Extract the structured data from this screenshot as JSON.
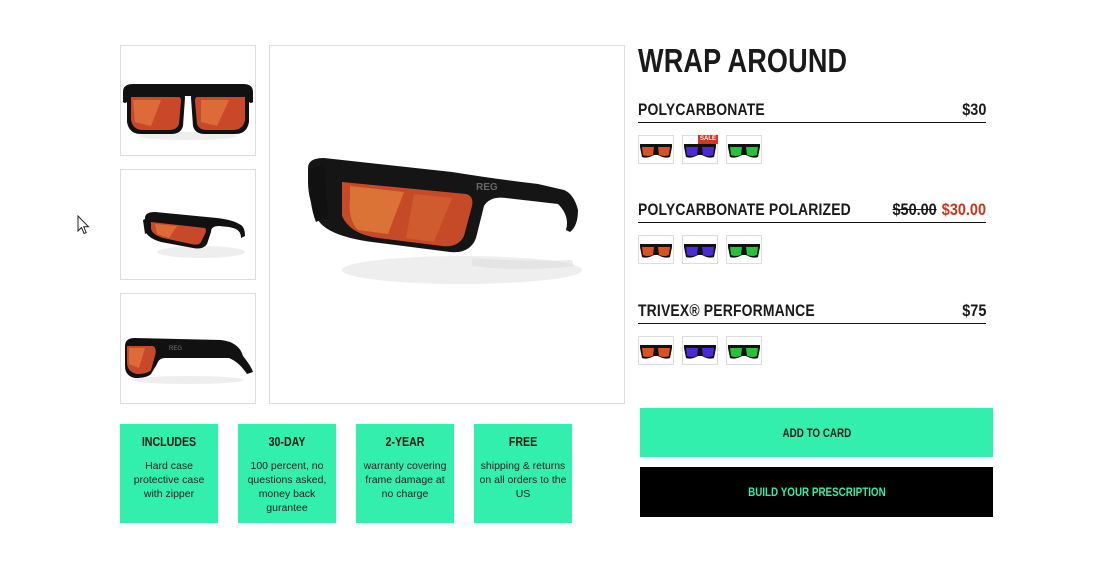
{
  "product": {
    "title": "WRAP AROUND",
    "main_image_icon": "sunglasses-angled-view",
    "thumbnails": [
      {
        "icon": "sunglasses-front-view"
      },
      {
        "icon": "sunglasses-angled-view"
      },
      {
        "icon": "sunglasses-side-view"
      }
    ]
  },
  "options": [
    {
      "name": "POLYCARBONATE",
      "price": "$30",
      "swatches": [
        {
          "color": "orange-mirror",
          "hex": "#d9531f",
          "badge": ""
        },
        {
          "color": "purple-mirror",
          "hex": "#4a2bd6",
          "badge": "SALE"
        },
        {
          "color": "green-mirror",
          "hex": "#27c23a",
          "badge": ""
        }
      ]
    },
    {
      "name": "POLYCARBONATE POLARIZED",
      "old_price": "$50.00",
      "sale_price": "$30.00",
      "swatches": [
        {
          "color": "orange-mirror",
          "hex": "#d9531f"
        },
        {
          "color": "purple-mirror",
          "hex": "#4a2bd6"
        },
        {
          "color": "green-mirror",
          "hex": "#27c23a"
        }
      ]
    },
    {
      "name": "TRIVEX® PERFORMANCE",
      "price": "$75",
      "swatches": [
        {
          "color": "orange-mirror",
          "hex": "#d9531f"
        },
        {
          "color": "purple-mirror",
          "hex": "#4a2bd6"
        },
        {
          "color": "green-mirror",
          "hex": "#27c23a"
        }
      ]
    }
  ],
  "features": [
    {
      "title": "INCLUDES",
      "text": "Hard case protective case with zipper"
    },
    {
      "title": "30-DAY",
      "text": "100 percent, no questions asked, money back gurantee"
    },
    {
      "title": "2-YEAR",
      "text": "warranty covering frame damage at no charge"
    },
    {
      "title": "FREE",
      "text": "shipping & returns on all orders to the US"
    }
  ],
  "buttons": {
    "add_to_cart": "ADD TO CARD",
    "build_rx": "BUILD YOUR PRESCRIPTION"
  },
  "colors": {
    "accent": "#33efad",
    "sale": "#c9341a",
    "dark": "#000000"
  },
  "logo_text": "REG"
}
